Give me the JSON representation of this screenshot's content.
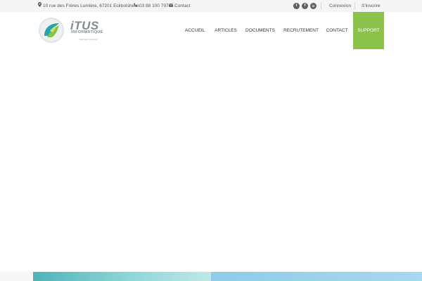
{
  "topbar": {
    "address": "10 rue des Frères Lumière, 67201 Eckbolsheim",
    "phone": "03 88 100 797",
    "contact": "Contact",
    "social": {
      "twitter_glyph": "t",
      "facebook_glyph": "f",
      "linkedin_glyph": "in"
    },
    "login": "Connexion",
    "register": "S'inscrire"
  },
  "logo": {
    "word": "iTUS",
    "sub": "INFORMATIQUE",
    "tagline": "Maîtriser l'essentiel",
    "colors": {
      "green": "#8bc34a",
      "teal": "#2aa3a8",
      "gray": "#7f8b95"
    }
  },
  "nav": {
    "items": [
      "ACCUEIL",
      "ARTICLES",
      "DOCUMENTS",
      "RECRUTEMENT",
      "CONTACT"
    ],
    "support": "SUPPORT"
  },
  "colors": {
    "accent": "#8bc34a",
    "topbar_bg": "#f5f5f5",
    "social_bg": "#606060"
  }
}
